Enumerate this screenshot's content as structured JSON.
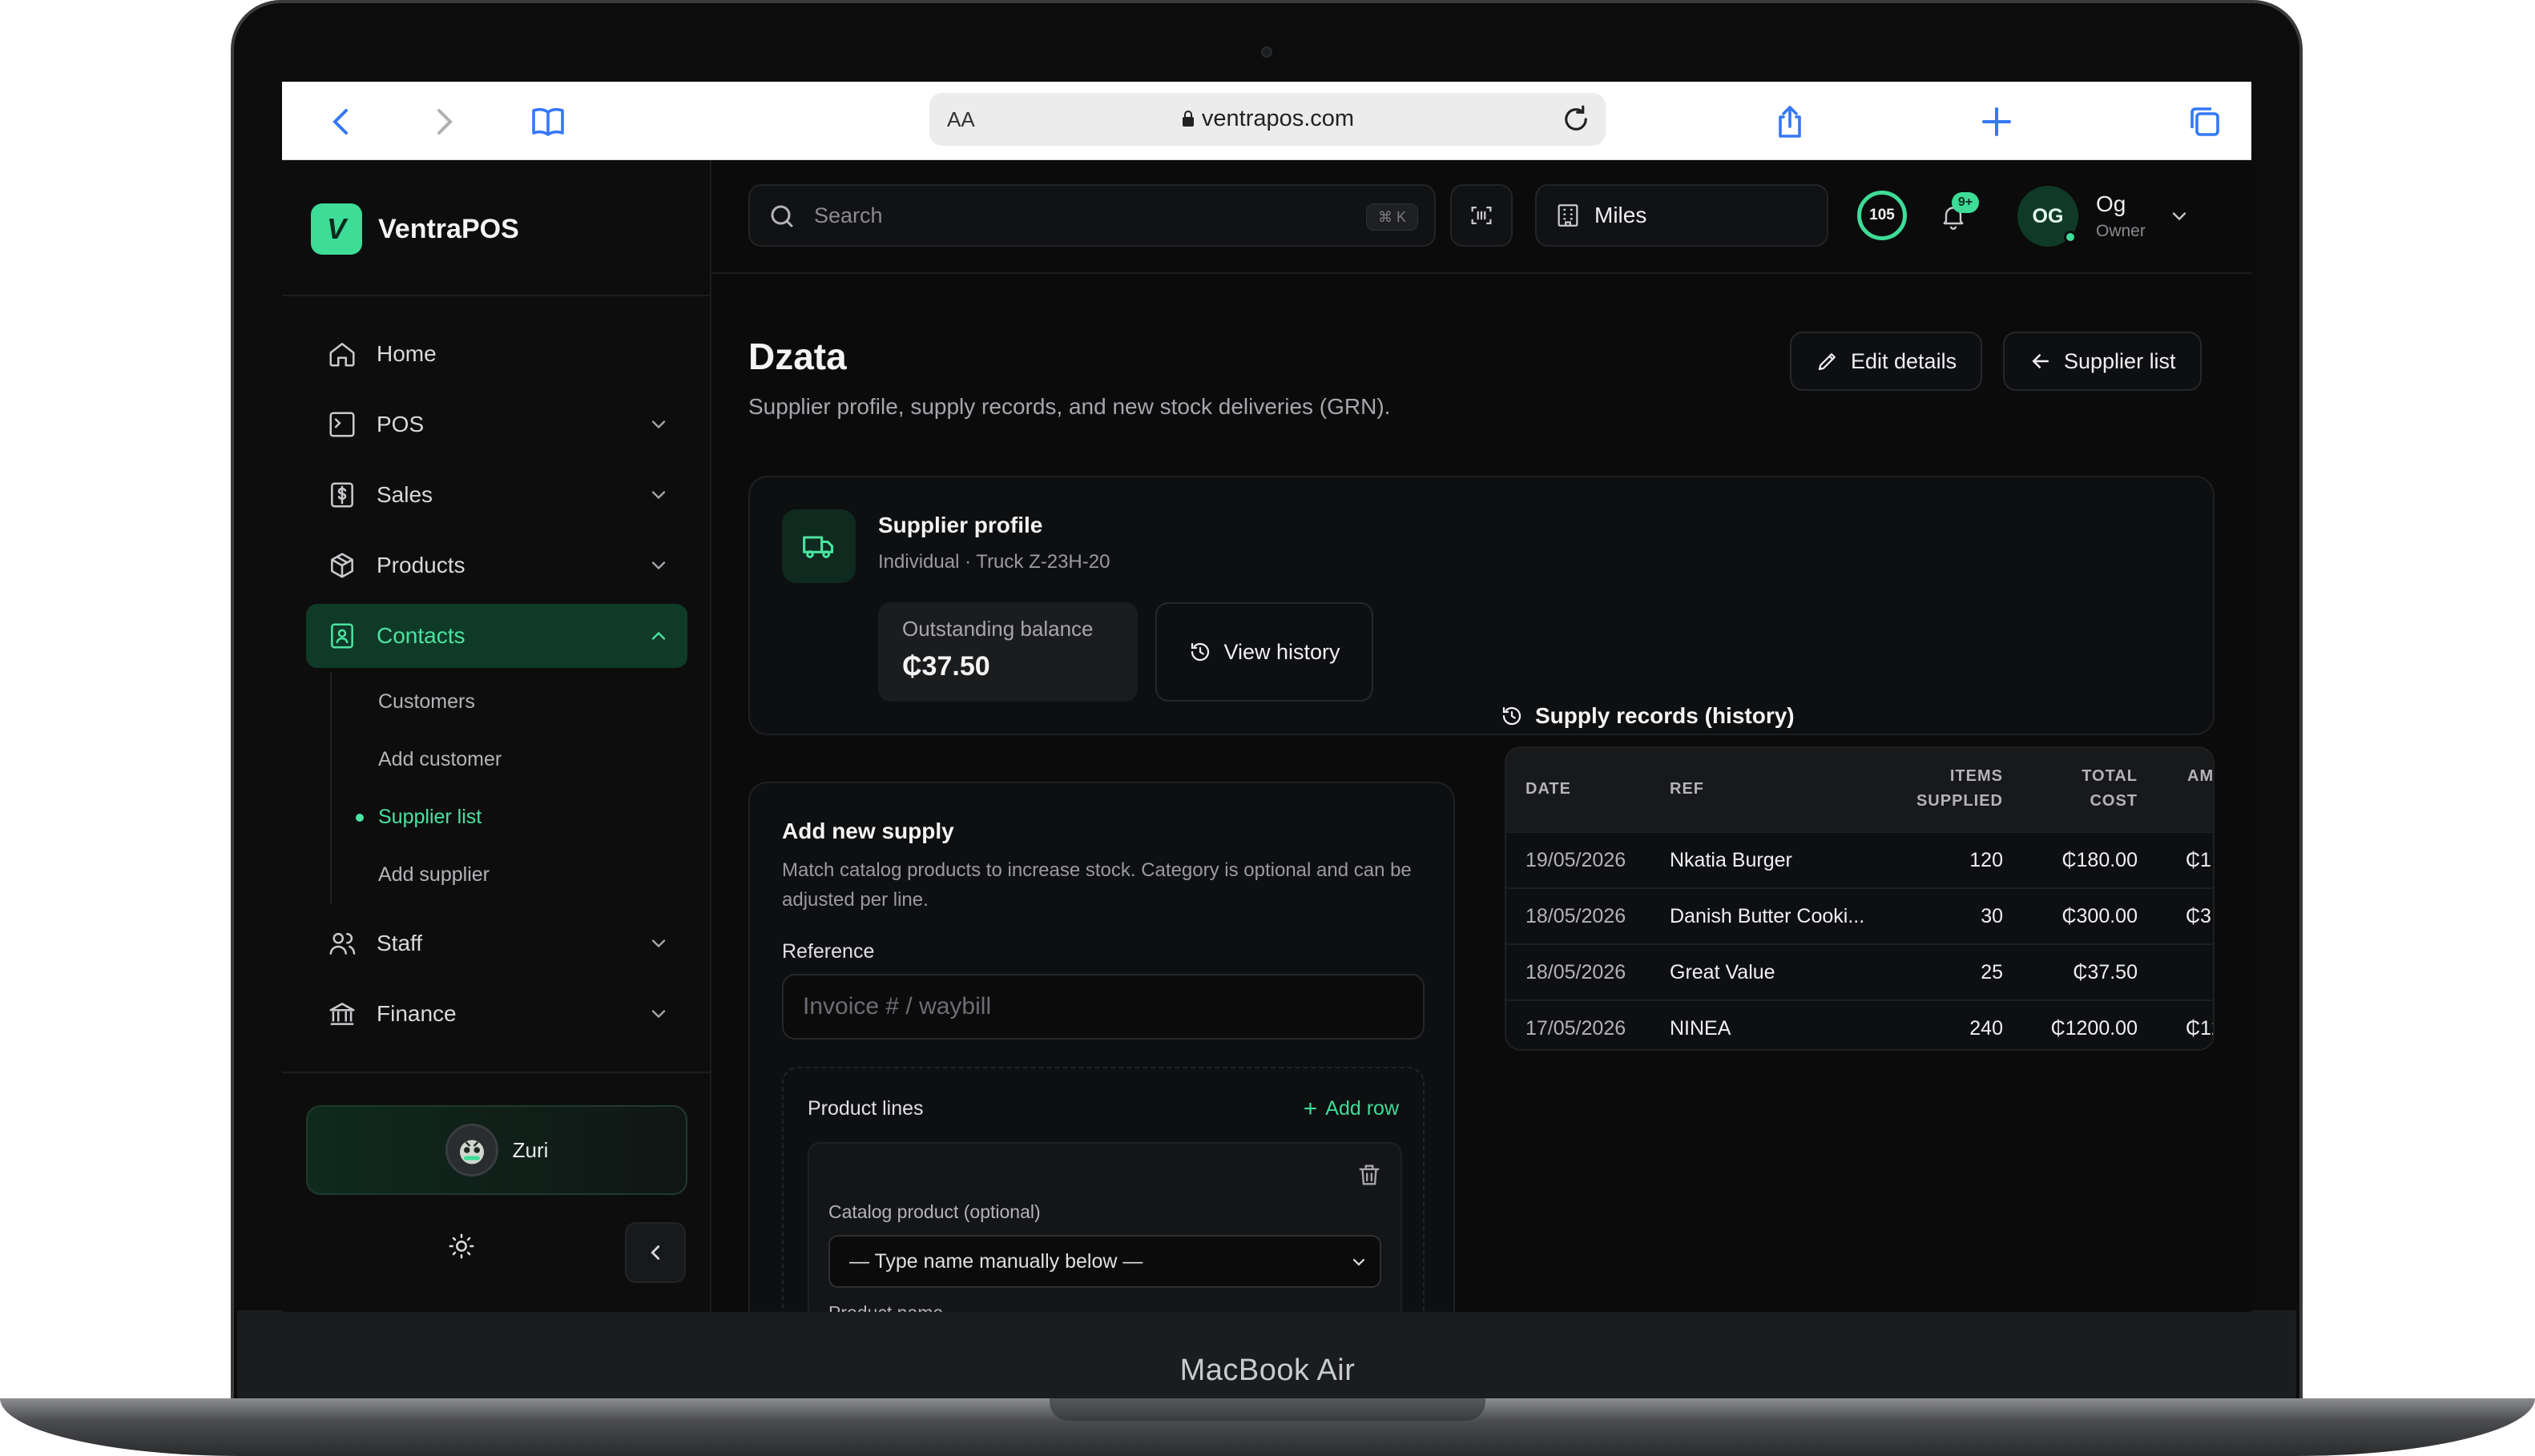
{
  "device": {
    "brand": "MacBook Air"
  },
  "browser": {
    "text_size": "AA",
    "url": "ventrapos.com"
  },
  "sidebar": {
    "logo_letter": "V",
    "app_name": "VentraPOS",
    "items": [
      {
        "label": "Home"
      },
      {
        "label": "POS"
      },
      {
        "label": "Sales"
      },
      {
        "label": "Products"
      },
      {
        "label": "Contacts",
        "active": true
      },
      {
        "label": "Staff"
      },
      {
        "label": "Finance"
      }
    ],
    "contacts_sub": [
      {
        "label": "Customers"
      },
      {
        "label": "Add customer"
      },
      {
        "label": "Supplier list",
        "active": true
      },
      {
        "label": "Add supplier"
      }
    ],
    "user_card": {
      "name": "Zuri"
    }
  },
  "topbar": {
    "search_placeholder": "Search",
    "search_shortcut": "⌘ K",
    "store": "Miles",
    "score": "105",
    "notification_badge": "9+",
    "profile": {
      "initials": "OG",
      "name": "Og",
      "role": "Owner"
    }
  },
  "page": {
    "title": "Dzata",
    "subtitle": "Supplier profile, supply records, and new stock deliveries (GRN).",
    "edit_button": "Edit details",
    "back_button": "Supplier list"
  },
  "profile_card": {
    "title": "Supplier profile",
    "subtitle": "Individual · Truck Z-23H-20",
    "balance_label": "Outstanding balance",
    "balance_value": "₵37.50",
    "history_button": "View history"
  },
  "supply_form": {
    "title": "Add new supply",
    "description": "Match catalog products to increase stock. Category is optional and can be adjusted per line.",
    "reference_label": "Reference",
    "reference_placeholder": "Invoice # / waybill",
    "lines_title": "Product lines",
    "add_row": "Add row",
    "catalog_label": "Catalog product (optional)",
    "catalog_selected": "— Type name manually below —",
    "product_name_label": "Product name"
  },
  "records": {
    "title": "Supply records (history)",
    "columns": [
      "DATE",
      "REF",
      "ITEMS SUPPLIED",
      "TOTAL COST",
      "AM"
    ],
    "rows": [
      {
        "date": "19/05/2026",
        "ref": "Nkatia Burger",
        "items": "120",
        "total": "₵180.00",
        "am": "₵1"
      },
      {
        "date": "18/05/2026",
        "ref": "Danish Butter Cooki...",
        "items": "30",
        "total": "₵300.00",
        "am": "₵3"
      },
      {
        "date": "18/05/2026",
        "ref": "Great Value",
        "items": "25",
        "total": "₵37.50",
        "am": ""
      },
      {
        "date": "17/05/2026",
        "ref": "NINEA",
        "items": "240",
        "total": "₵1200.00",
        "am": "₵12"
      }
    ]
  },
  "colors": {
    "accent": "#3ddc97",
    "active_bg": "#0f3a28",
    "background": "#0b0b0c"
  }
}
